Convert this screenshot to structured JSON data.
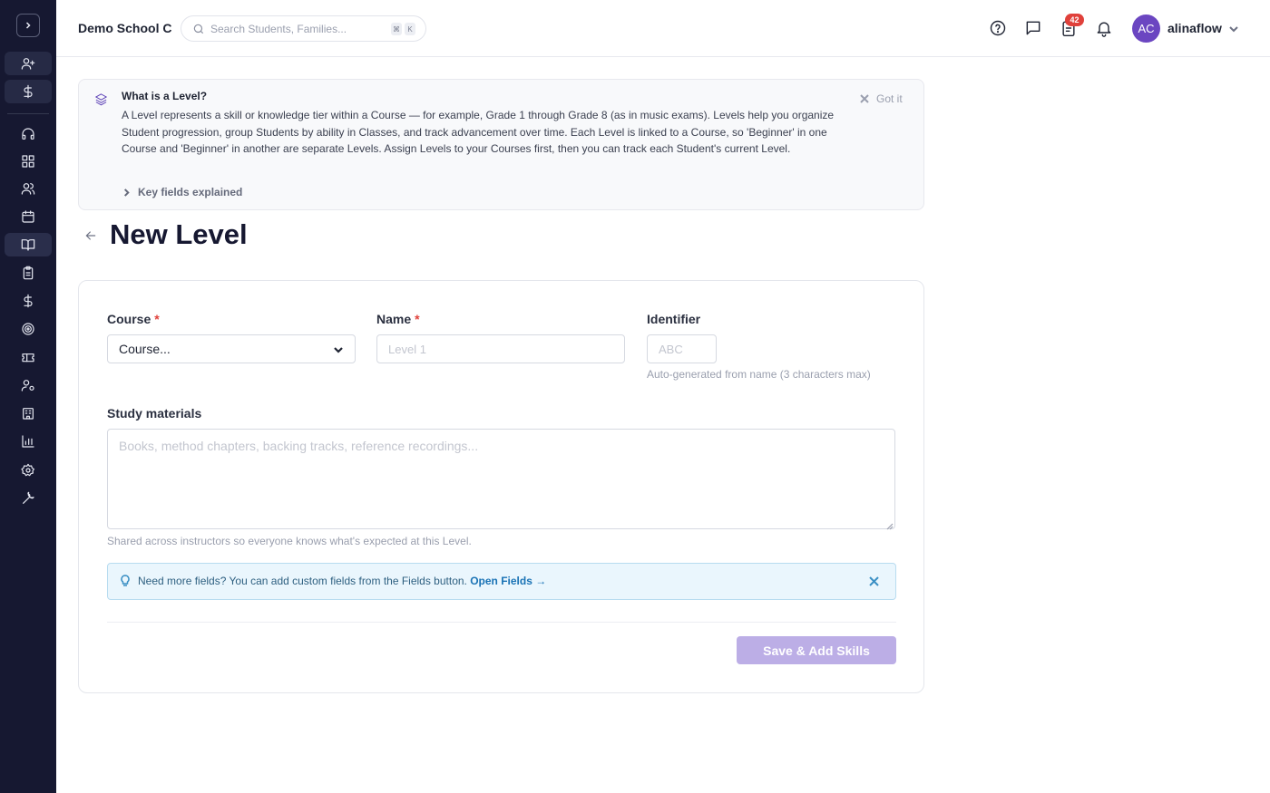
{
  "header": {
    "school_name": "Demo School C",
    "search_placeholder": "Search Students, Families...",
    "search_kbd_1": "⌘",
    "search_kbd_2": "K",
    "icons": [
      "help-circle-icon",
      "message-square-icon",
      "clipboard-icon",
      "bell-icon"
    ],
    "notification_badge": "42",
    "avatar_initials": "AC",
    "username": "alinaflow"
  },
  "sidebar": {
    "items": [
      {
        "name": "add-user-icon"
      },
      {
        "name": "dollar-icon"
      },
      {
        "name": "headset-icon"
      },
      {
        "name": "dashboard-icon"
      },
      {
        "name": "users-icon"
      },
      {
        "name": "calendar-icon"
      },
      {
        "name": "book-open-icon",
        "active": true
      },
      {
        "name": "clipboard-list-icon"
      },
      {
        "name": "dollar-icon"
      },
      {
        "name": "target-icon"
      },
      {
        "name": "ticket-icon"
      },
      {
        "name": "user-cog-icon"
      },
      {
        "name": "building-icon"
      },
      {
        "name": "bar-chart-icon"
      },
      {
        "name": "settings-icon"
      },
      {
        "name": "wrench-icon"
      }
    ]
  },
  "info": {
    "title": "What is a Level?",
    "body": "A Level represents a skill or knowledge tier within a Course — for example, Grade 1 through Grade 8 (as in music exams). Levels help you organize Student progression, group Students by ability in Classes, and track advancement over time. Each Level is linked to a Course, so 'Beginner' in one Course and 'Beginner' in another are separate Levels. Assign Levels to your Courses first, then you can track each Student's current Level.",
    "got_it": "Got it",
    "key_fields": "Key fields explained"
  },
  "page": {
    "title": "New Level"
  },
  "form": {
    "course_label": "Course",
    "course_value": "Course...",
    "required_mark": "*",
    "name_label": "Name",
    "name_placeholder": "Level 1",
    "identifier_label": "Identifier",
    "identifier_placeholder": "ABC",
    "identifier_hint": "Auto-generated from name (3 characters max)",
    "materials_label": "Study materials",
    "materials_placeholder": "Books, method chapters, backing tracks, reference recordings...",
    "materials_hint": "Shared across instructors so everyone knows what's expected at this Level.",
    "tip_text": "Need more fields? You can add custom fields from the Fields button.",
    "tip_link": "Open Fields →",
    "save_button": "Save & Add Skills"
  },
  "colors": {
    "sidebar_bg": "#161831",
    "accent_purple": "#6b46c1",
    "save_disabled": "#bcaee6",
    "tip_bg": "#eaf6fd",
    "badge_red": "#e0413b"
  }
}
